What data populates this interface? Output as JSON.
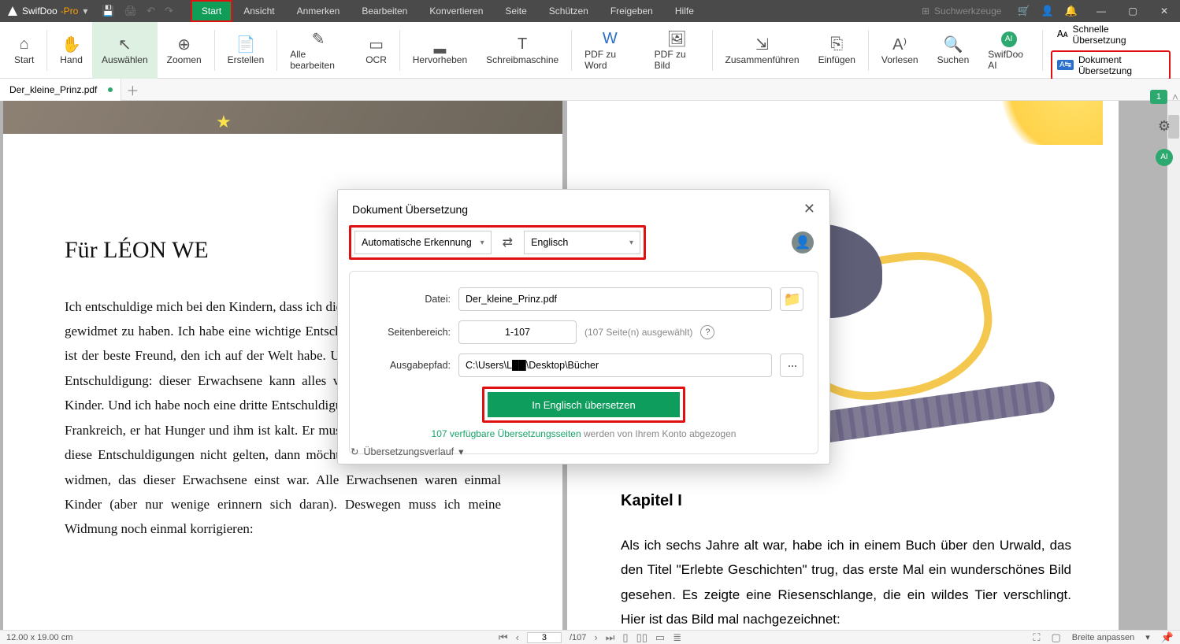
{
  "app": {
    "name": "SwifDoo",
    "suffix": "-Pro"
  },
  "menus": [
    "Start",
    "Ansicht",
    "Anmerken",
    "Bearbeiten",
    "Konvertieren",
    "Seite",
    "Schützen",
    "Freigeben",
    "Hilfe"
  ],
  "search_placeholder": "Suchwerkzeuge",
  "ribbon": {
    "start": "Start",
    "hand": "Hand",
    "select": "Auswählen",
    "zoom": "Zoomen",
    "create": "Erstellen",
    "edit_all": "Alle bearbeiten",
    "ocr": "OCR",
    "highlight": "Hervorheben",
    "typewriter": "Schreibmaschine",
    "pdf_word": "PDF zu Word",
    "pdf_image": "PDF zu Bild",
    "merge": "Zusammenführen",
    "insert": "Einfügen",
    "read": "Vorlesen",
    "search": "Suchen",
    "ai": "SwifDoo AI",
    "quick_trans": "Schnelle Übersetzung",
    "doc_trans": "Dokument Übersetzung"
  },
  "tab": {
    "filename": "Der_kleine_Prinz.pdf"
  },
  "page_left": {
    "heading": "Für LÉON WE",
    "body": "Ich entschuldige mich bei den Kindern, dass ich dieses Buch einem Erwachsenen gewidmet zu haben. Ich habe eine wichtige Entschuldigung: Dieser Erwachsene ist der beste Freund, den ich auf der Welt habe. Und ich habe noch eine andere Entschuldigung: dieser Erwachsene kann alles verstehen – sogar Bücher für Kinder. Und ich habe noch eine dritte Entschuldigung: dieser Erwachsene lebt in Frankreich, er hat Hunger und ihm ist kalt. Er muss getröstet werden. Wenn alle diese Entschuldigungen nicht gelten, dann möchte ich dieses Buch dem Kind widmen, das dieser Erwachsene einst war. Alle Erwachsenen waren einmal Kinder (aber nur wenige erinnern sich daran). Deswegen muss ich meine Widmung noch einmal korrigieren:"
  },
  "page_right": {
    "heading": "Kapitel I",
    "body": "Als ich sechs Jahre alt war, habe ich in einem Buch über den Urwald, das den Titel \"Erlebte Geschichten\" trug, das erste Mal ein wunderschönes Bild gesehen. Es zeigte eine Riesenschlange, die ein wildes Tier verschlingt. Hier ist das Bild mal nachgezeichnet:"
  },
  "dialog": {
    "title": "Dokument Übersetzung",
    "from": "Automatische Erkennung",
    "to": "Englisch",
    "file_label": "Datei:",
    "file_value": "Der_kleine_Prinz.pdf",
    "range_label": "Seitenbereich:",
    "range_value": "1-107",
    "range_note": "(107 Seite(n) ausgewählt)",
    "output_label": "Ausgabepfad:",
    "output_value": "C:\\Users\\L██\\Desktop\\Bücher",
    "go": "In Englisch übersetzen",
    "credits_link": "107 verfügbare Übersetzungsseiten",
    "credits_rest": " werden von Ihrem Konto abgezogen",
    "history": "Übersetzungsverlauf"
  },
  "status": {
    "dims": "12.00 x 19.00 cm",
    "page": "3",
    "total": "/107",
    "fit": "Breite anpassen"
  },
  "side_badge": "1"
}
